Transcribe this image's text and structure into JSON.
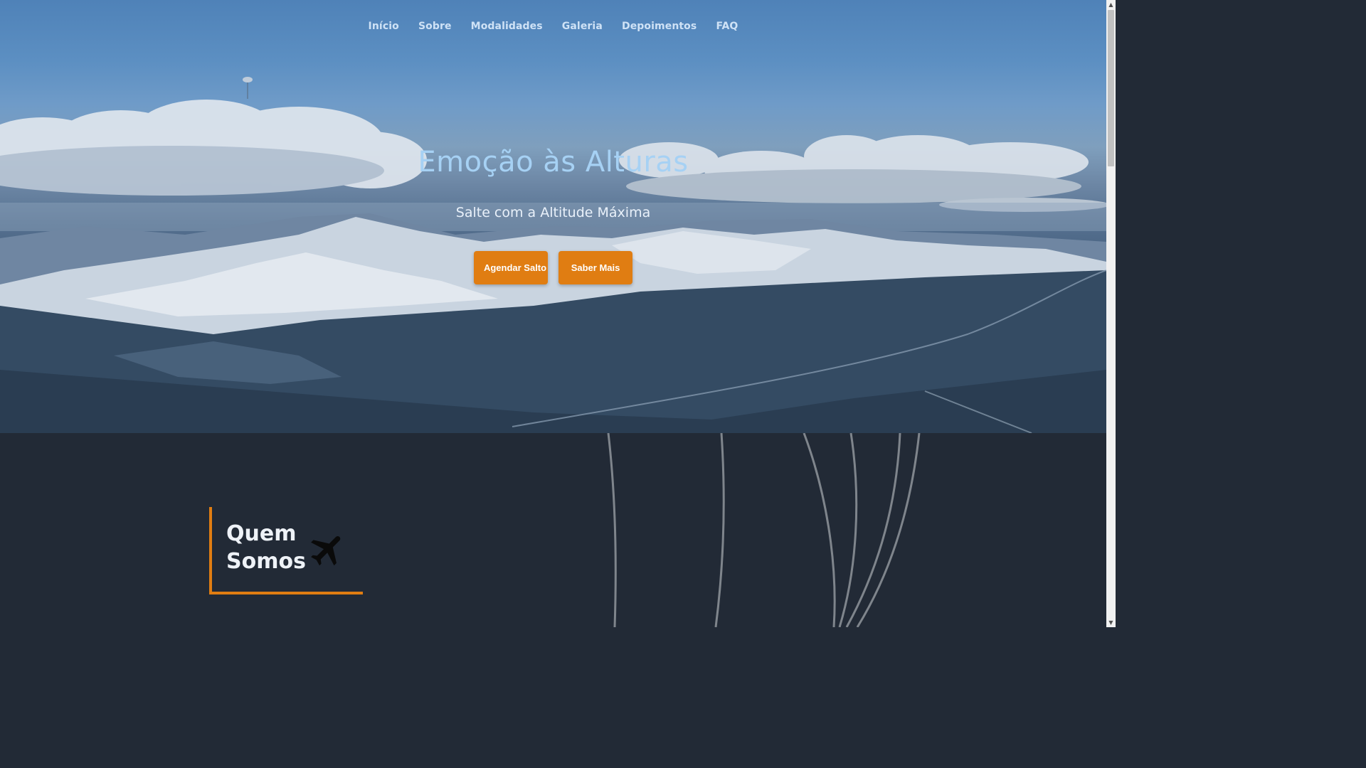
{
  "nav": {
    "items": [
      {
        "label": "Início"
      },
      {
        "label": "Sobre"
      },
      {
        "label": "Modalidades"
      },
      {
        "label": "Galeria"
      },
      {
        "label": "Depoimentos"
      },
      {
        "label": "FAQ"
      }
    ]
  },
  "hero": {
    "title": "Emoção às Alturas",
    "subtitle": "Salte com a Altitude Máxima",
    "primary_button": "Agendar Salto",
    "secondary_button": "Saber Mais"
  },
  "about": {
    "title": "Quem Somos",
    "icon": "airplane-icon"
  },
  "colors": {
    "accent": "#e07d12",
    "hero_title": "#a6d1f4",
    "section_bg": "#222a36"
  }
}
